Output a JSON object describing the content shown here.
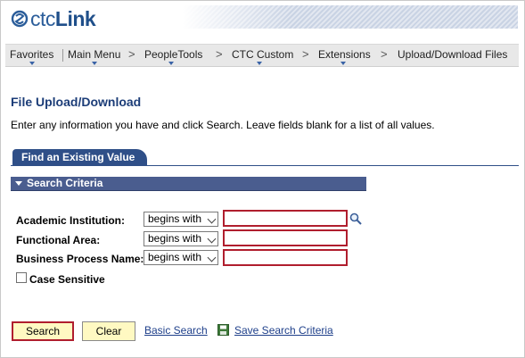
{
  "header": {
    "logo_text_ctc": "ctc",
    "logo_text_link": "Link"
  },
  "nav": {
    "items": [
      {
        "label": "Favorites"
      },
      {
        "label": "Main Menu"
      },
      {
        "label": "PeopleTools"
      },
      {
        "label": "CTC Custom"
      },
      {
        "label": "Extensions"
      },
      {
        "label": "Upload/Download Files"
      }
    ],
    "separator": ">"
  },
  "page": {
    "title": "File Upload/Download",
    "instructions": "Enter any information you have and click Search. Leave fields blank for a list of all values."
  },
  "tab": {
    "label": "Find an Existing Value"
  },
  "search_criteria": {
    "header": "Search Criteria",
    "fields": [
      {
        "label": "Academic Institution:",
        "operator": "begins with",
        "value": ""
      },
      {
        "label": "Functional Area:",
        "operator": "begins with",
        "value": ""
      },
      {
        "label": "Business Process Name:",
        "operator": "begins with",
        "value": ""
      }
    ],
    "case_sensitive_label": "Case Sensitive",
    "case_sensitive_checked": false
  },
  "actions": {
    "search_label": "Search",
    "clear_label": "Clear",
    "basic_search_label": "Basic Search",
    "save_search_label": "Save Search Criteria"
  },
  "icons": {
    "lookup": "magnifier-icon",
    "save": "save-icon",
    "collapse": "triangle-down-icon"
  },
  "colors": {
    "accent_blue": "#2f4f88",
    "highlight_red": "#b01e2e",
    "button_yellow": "#fff9c2",
    "link_blue": "#1e3f8a"
  }
}
